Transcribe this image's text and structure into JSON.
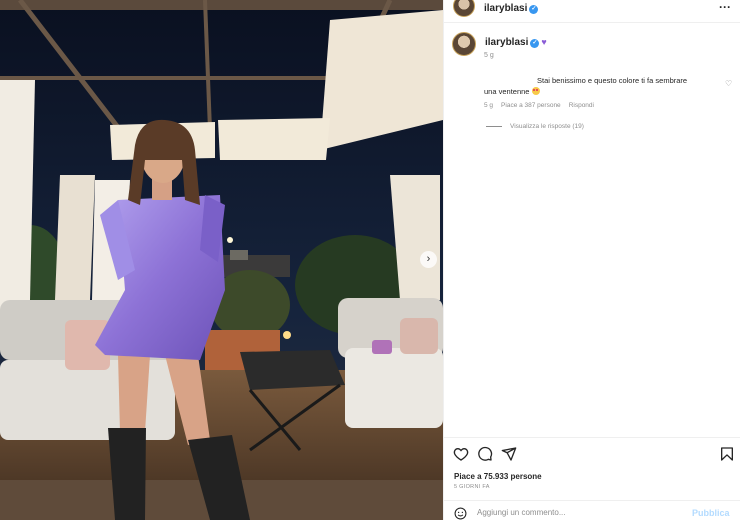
{
  "post": {
    "username": "ilaryblasi",
    "verified_icon": "verified-badge-icon",
    "more_icon": "more-horizontal-icon"
  },
  "caption": {
    "username": "ilaryblasi",
    "emoji": "purple-heart-emoji",
    "time": "5 g"
  },
  "comment": {
    "text_line1": "Stai benissimo e questo colore ti fa sembrare",
    "text_line2": "una ventenne",
    "emoji": "heart-eyes-emoji",
    "time": "5 g",
    "likes": "Piace a 387 persone",
    "reply": "Rispondi",
    "view_replies": "Visualizza le risposte (19)"
  },
  "actions": {
    "icons": [
      "heart-icon",
      "comment-icon",
      "share-icon",
      "bookmark-icon"
    ]
  },
  "likes": "Piace a 75.933 persone",
  "ago": "5 GIORNI FA",
  "add_comment": {
    "placeholder": "Aggiungi un commento...",
    "publish_label": "Pubblica"
  },
  "carousel": {
    "next_icon": "chevron-right-icon"
  },
  "colors": {
    "accent_blue": "#3897f0",
    "publish_disabled": "#b3dbff",
    "dress_purple": "#8d72d6"
  }
}
